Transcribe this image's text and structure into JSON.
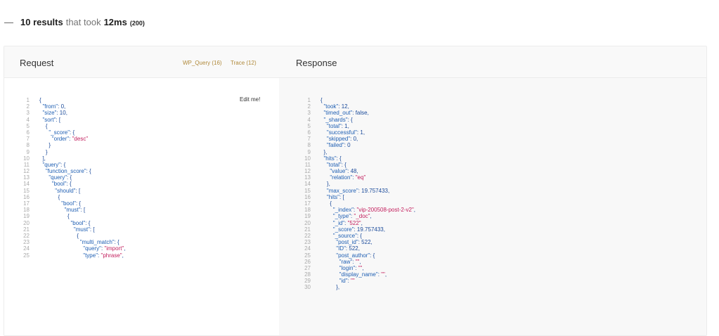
{
  "summary": {
    "collapse_glyph": "—",
    "results": "10 results",
    "that_took": "that took",
    "time": "12ms",
    "status": "(200)"
  },
  "request": {
    "title": "Request",
    "wp_query_link": "WP_Query (16)",
    "trace_link": "Trace (12)",
    "edit_label": "Edit me!",
    "lines": [
      [
        {
          "t": "p",
          "v": "{"
        }
      ],
      [
        {
          "t": "p",
          "v": "  "
        },
        {
          "t": "k",
          "v": "\"from\""
        },
        {
          "t": "p",
          "v": ": 0,"
        }
      ],
      [
        {
          "t": "p",
          "v": "  "
        },
        {
          "t": "k",
          "v": "\"size\""
        },
        {
          "t": "p",
          "v": ": 10,"
        }
      ],
      [
        {
          "t": "p",
          "v": "  "
        },
        {
          "t": "k",
          "v": "\"sort\""
        },
        {
          "t": "p",
          "v": ": ["
        }
      ],
      [
        {
          "t": "p",
          "v": "    {"
        }
      ],
      [
        {
          "t": "p",
          "v": "      "
        },
        {
          "t": "k",
          "v": "\"_score\""
        },
        {
          "t": "p",
          "v": ": {"
        }
      ],
      [
        {
          "t": "p",
          "v": "        "
        },
        {
          "t": "k",
          "v": "\"order\""
        },
        {
          "t": "p",
          "v": ": "
        },
        {
          "t": "s",
          "v": "\"desc\""
        }
      ],
      [
        {
          "t": "p",
          "v": "      }"
        }
      ],
      [
        {
          "t": "p",
          "v": "    }"
        }
      ],
      [
        {
          "t": "p",
          "v": "  ],"
        }
      ],
      [
        {
          "t": "p",
          "v": "  "
        },
        {
          "t": "k",
          "v": "\"query\""
        },
        {
          "t": "p",
          "v": ": {"
        }
      ],
      [
        {
          "t": "p",
          "v": "    "
        },
        {
          "t": "k",
          "v": "\"function_score\""
        },
        {
          "t": "p",
          "v": ": {"
        }
      ],
      [
        {
          "t": "p",
          "v": "      "
        },
        {
          "t": "k",
          "v": "\"query\""
        },
        {
          "t": "p",
          "v": ": {"
        }
      ],
      [
        {
          "t": "p",
          "v": "        "
        },
        {
          "t": "k",
          "v": "\"bool\""
        },
        {
          "t": "p",
          "v": ": {"
        }
      ],
      [
        {
          "t": "p",
          "v": "          "
        },
        {
          "t": "k",
          "v": "\"should\""
        },
        {
          "t": "p",
          "v": ": ["
        }
      ],
      [
        {
          "t": "p",
          "v": "            {"
        }
      ],
      [
        {
          "t": "p",
          "v": "              "
        },
        {
          "t": "k",
          "v": "\"bool\""
        },
        {
          "t": "p",
          "v": ": {"
        }
      ],
      [
        {
          "t": "p",
          "v": "                "
        },
        {
          "t": "k",
          "v": "\"must\""
        },
        {
          "t": "p",
          "v": ": ["
        }
      ],
      [
        {
          "t": "p",
          "v": "                  {"
        }
      ],
      [
        {
          "t": "p",
          "v": "                    "
        },
        {
          "t": "k",
          "v": "\"bool\""
        },
        {
          "t": "p",
          "v": ": {"
        }
      ],
      [
        {
          "t": "p",
          "v": "                      "
        },
        {
          "t": "k",
          "v": "\"must\""
        },
        {
          "t": "p",
          "v": ": ["
        }
      ],
      [
        {
          "t": "p",
          "v": "                        {"
        }
      ],
      [
        {
          "t": "p",
          "v": "                          "
        },
        {
          "t": "k",
          "v": "\"multi_match\""
        },
        {
          "t": "p",
          "v": ": {"
        }
      ],
      [
        {
          "t": "p",
          "v": "                            "
        },
        {
          "t": "k",
          "v": "\"query\""
        },
        {
          "t": "p",
          "v": ": "
        },
        {
          "t": "s",
          "v": "\"import\""
        },
        {
          "t": "p",
          "v": ","
        }
      ],
      [
        {
          "t": "p",
          "v": "                            "
        },
        {
          "t": "k",
          "v": "\"type\""
        },
        {
          "t": "p",
          "v": ": "
        },
        {
          "t": "s",
          "v": "\"phrase\""
        },
        {
          "t": "p",
          "v": ","
        }
      ]
    ]
  },
  "response": {
    "title": "Response",
    "lines": [
      [
        {
          "t": "p",
          "v": "{"
        }
      ],
      [
        {
          "t": "p",
          "v": "  "
        },
        {
          "t": "k",
          "v": "\"took\""
        },
        {
          "t": "p",
          "v": ": 12,"
        }
      ],
      [
        {
          "t": "p",
          "v": "  "
        },
        {
          "t": "k",
          "v": "\"timed_out\""
        },
        {
          "t": "p",
          "v": ": false,"
        }
      ],
      [
        {
          "t": "p",
          "v": "  "
        },
        {
          "t": "k",
          "v": "\"_shards\""
        },
        {
          "t": "p",
          "v": ": {"
        }
      ],
      [
        {
          "t": "p",
          "v": "    "
        },
        {
          "t": "k",
          "v": "\"total\""
        },
        {
          "t": "p",
          "v": ": 1,"
        }
      ],
      [
        {
          "t": "p",
          "v": "    "
        },
        {
          "t": "k",
          "v": "\"successful\""
        },
        {
          "t": "p",
          "v": ": 1,"
        }
      ],
      [
        {
          "t": "p",
          "v": "    "
        },
        {
          "t": "k",
          "v": "\"skipped\""
        },
        {
          "t": "p",
          "v": ": 0,"
        }
      ],
      [
        {
          "t": "p",
          "v": "    "
        },
        {
          "t": "k",
          "v": "\"failed\""
        },
        {
          "t": "p",
          "v": ": 0"
        }
      ],
      [
        {
          "t": "p",
          "v": "  },"
        }
      ],
      [
        {
          "t": "p",
          "v": "  "
        },
        {
          "t": "k",
          "v": "\"hits\""
        },
        {
          "t": "p",
          "v": ": {"
        }
      ],
      [
        {
          "t": "p",
          "v": "    "
        },
        {
          "t": "k",
          "v": "\"total\""
        },
        {
          "t": "p",
          "v": ": {"
        }
      ],
      [
        {
          "t": "p",
          "v": "      "
        },
        {
          "t": "k",
          "v": "\"value\""
        },
        {
          "t": "p",
          "v": ": 48,"
        }
      ],
      [
        {
          "t": "p",
          "v": "      "
        },
        {
          "t": "k",
          "v": "\"relation\""
        },
        {
          "t": "p",
          "v": ": "
        },
        {
          "t": "s",
          "v": "\"eq\""
        }
      ],
      [
        {
          "t": "p",
          "v": "    },"
        }
      ],
      [
        {
          "t": "p",
          "v": "    "
        },
        {
          "t": "k",
          "v": "\"max_score\""
        },
        {
          "t": "p",
          "v": ": 19.757433,"
        }
      ],
      [
        {
          "t": "p",
          "v": "    "
        },
        {
          "t": "k",
          "v": "\"hits\""
        },
        {
          "t": "p",
          "v": ": ["
        }
      ],
      [
        {
          "t": "p",
          "v": "      {"
        }
      ],
      [
        {
          "t": "p",
          "v": "        "
        },
        {
          "t": "k",
          "v": "\"_index\""
        },
        {
          "t": "p",
          "v": ": "
        },
        {
          "t": "s",
          "v": "\"vip-200508-post-2-v2\""
        },
        {
          "t": "p",
          "v": ","
        }
      ],
      [
        {
          "t": "p",
          "v": "        "
        },
        {
          "t": "k",
          "v": "\"_type\""
        },
        {
          "t": "p",
          "v": ": "
        },
        {
          "t": "s",
          "v": "\"_doc\""
        },
        {
          "t": "p",
          "v": ","
        }
      ],
      [
        {
          "t": "p",
          "v": "        "
        },
        {
          "t": "k",
          "v": "\"_id\""
        },
        {
          "t": "p",
          "v": ": "
        },
        {
          "t": "s",
          "v": "\"522\""
        },
        {
          "t": "p",
          "v": ","
        }
      ],
      [
        {
          "t": "p",
          "v": "        "
        },
        {
          "t": "k",
          "v": "\"_score\""
        },
        {
          "t": "p",
          "v": ": 19.757433,"
        }
      ],
      [
        {
          "t": "p",
          "v": "        "
        },
        {
          "t": "k",
          "v": "\"_source\""
        },
        {
          "t": "p",
          "v": ": {"
        }
      ],
      [
        {
          "t": "p",
          "v": "          "
        },
        {
          "t": "k",
          "v": "\"post_id\""
        },
        {
          "t": "p",
          "v": ": 522,"
        }
      ],
      [
        {
          "t": "p",
          "v": "          "
        },
        {
          "t": "k",
          "v": "\"ID\""
        },
        {
          "t": "p",
          "v": ": 522,"
        }
      ],
      [
        {
          "t": "p",
          "v": "          "
        },
        {
          "t": "k",
          "v": "\"post_author\""
        },
        {
          "t": "p",
          "v": ": {"
        }
      ],
      [
        {
          "t": "p",
          "v": "            "
        },
        {
          "t": "k",
          "v": "\"raw\""
        },
        {
          "t": "p",
          "v": ": "
        },
        {
          "t": "s",
          "v": "\"\""
        },
        {
          "t": "p",
          "v": ","
        }
      ],
      [
        {
          "t": "p",
          "v": "            "
        },
        {
          "t": "k",
          "v": "\"login\""
        },
        {
          "t": "p",
          "v": ": "
        },
        {
          "t": "s",
          "v": "\"\""
        },
        {
          "t": "p",
          "v": ","
        }
      ],
      [
        {
          "t": "p",
          "v": "            "
        },
        {
          "t": "k",
          "v": "\"display_name\""
        },
        {
          "t": "p",
          "v": ": "
        },
        {
          "t": "s",
          "v": "\"\""
        },
        {
          "t": "p",
          "v": ","
        }
      ],
      [
        {
          "t": "p",
          "v": "            "
        },
        {
          "t": "k",
          "v": "\"id\""
        },
        {
          "t": "p",
          "v": ": "
        },
        {
          "t": "s",
          "v": "\"\""
        }
      ],
      [
        {
          "t": "p",
          "v": "          },"
        }
      ]
    ]
  }
}
